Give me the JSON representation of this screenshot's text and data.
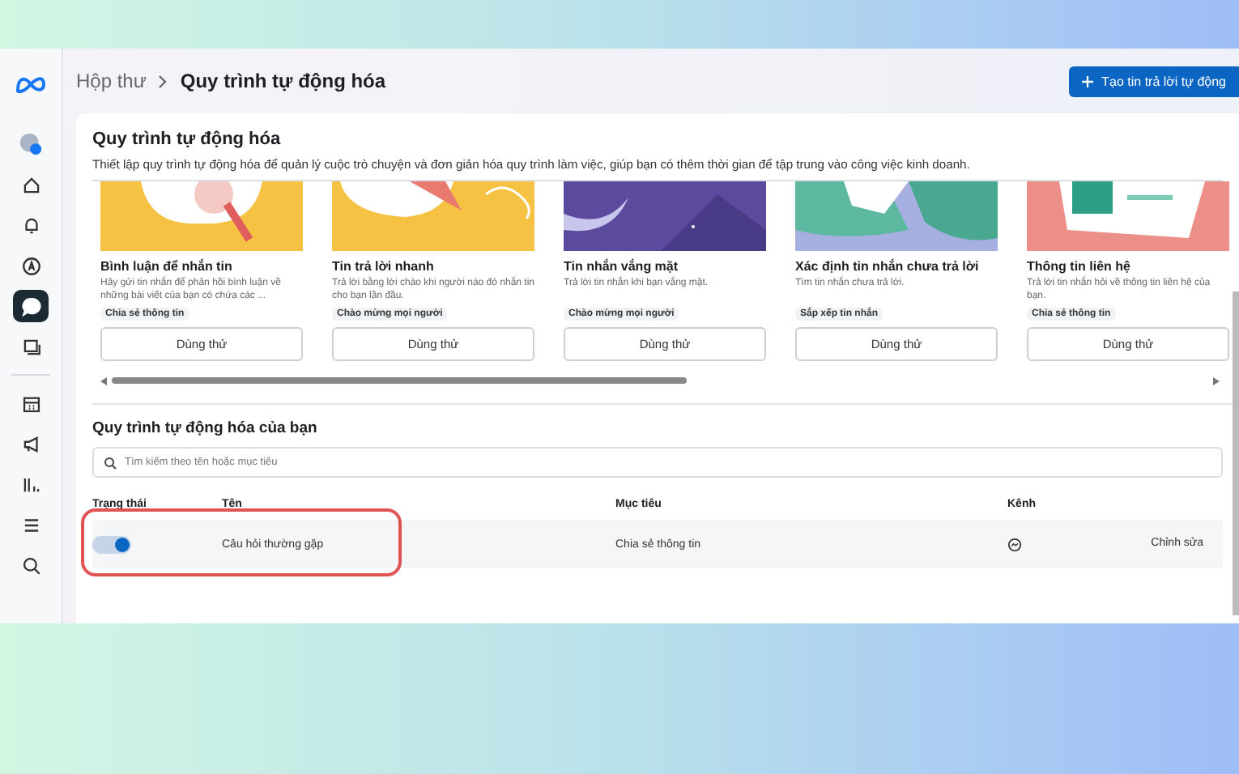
{
  "sidebar": {
    "items": [
      {
        "selected": false
      },
      {
        "selected": false
      },
      {
        "selected": false
      },
      {
        "selected": false
      },
      {
        "selected": true
      },
      {
        "selected": false
      },
      {
        "selected": false
      },
      {
        "selected": false
      },
      {
        "selected": false
      },
      {
        "selected": false
      },
      {
        "selected": false
      }
    ]
  },
  "breadcrumb": [
    "Hộp thư",
    "Quy trình tự động hóa"
  ],
  "create_button": {
    "label": "Tạo tin trả lời tự động"
  },
  "automation": {
    "title": "Quy trình tự động hóa",
    "description": "Thiết lập quy trình tự động hóa để quản lý cuộc trò chuyện và đơn giản hóa quy trình làm việc, giúp bạn có thêm thời gian để tập trung vào công việc kinh doanh.",
    "templates": [
      {
        "kind": "comment",
        "title": "Bình luận để nhắn tin",
        "description": "Hãy gửi tin nhắn để phản hồi bình luận về những bài viết của bạn có chứa các ...",
        "tag": "Chia sẻ thông tin",
        "button": "Dùng thử"
      },
      {
        "kind": "reply",
        "title": "Tin trả lời nhanh",
        "description": "Trả lời bằng lời chào khi người nào đó nhắn tin cho bạn lần đầu.",
        "tag": "Chào mừng mọi người",
        "button": "Dùng thử"
      },
      {
        "kind": "away",
        "title": "Tin nhắn vắng mặt",
        "description": "Trả lời tin nhắn khi bạn vắng mặt.",
        "tag": "Chào mừng mọi người",
        "button": "Dùng thử"
      },
      {
        "kind": "unanswered",
        "title": "Xác định tin nhắn chưa trả lời",
        "description": "Tìm tin nhắn chưa trả lời.",
        "tag": "Sắp xếp tin nhắn",
        "button": "Dùng thử"
      },
      {
        "kind": "contact",
        "title": "Thông tin liên hệ",
        "description": "Trả lời tin nhắn hỏi về thông tin liên hệ của bạn.",
        "tag": "Chia sẻ thông tin",
        "button": "Dùng thử"
      }
    ]
  },
  "my_automations": {
    "title": "Quy trình tự động hóa của bạn",
    "search": {
      "placeholder": "Tìm kiếm theo tên hoặc mục tiêu"
    },
    "table": {
      "columns": [
        "Trạng thái",
        "Tên",
        "Mục tiêu",
        "Kênh"
      ],
      "rows": [
        {
          "on": true,
          "annotated": true,
          "name": "Câu hỏi thường gặp",
          "goal": "Chia sẻ thông tin",
          "action": "Chỉnh sửa"
        }
      ]
    }
  }
}
